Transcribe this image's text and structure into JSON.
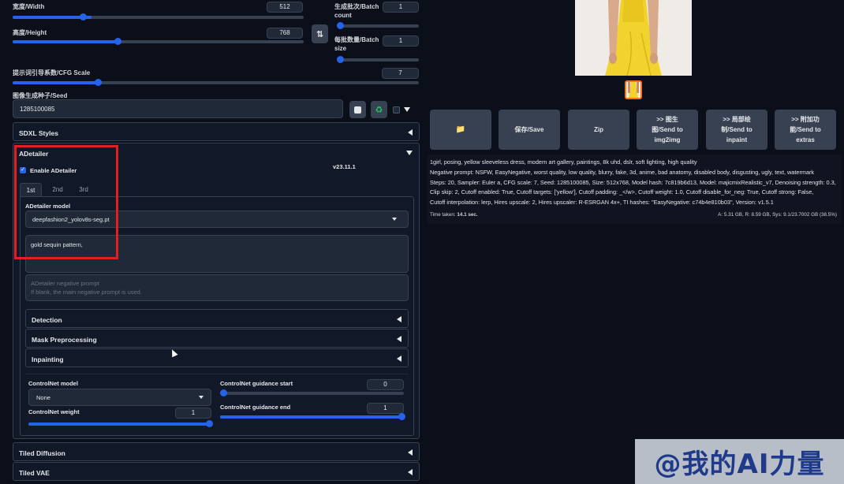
{
  "left": {
    "width": {
      "label": "宽度/Width",
      "value": "512",
      "fraction": 0.3
    },
    "height": {
      "label": "高度/Height",
      "value": "768",
      "fraction": 0.35
    },
    "batch_count": {
      "label_line1": "生成批次/Batch",
      "label_line2": "count",
      "value": "1",
      "fraction": 0.0
    },
    "batch_size": {
      "label_line1": "每批数量/Batch",
      "label_line2": "size",
      "value": "1",
      "fraction": 0.0
    },
    "cfg": {
      "label": "提示词引导系数/CFG Scale",
      "value": "7",
      "fraction": 0.21
    },
    "seed": {
      "label": "图像生成种子/Seed",
      "value": "1285100085"
    },
    "sdxl_styles": "SDXL Styles",
    "adetailer": {
      "title": "ADetailer",
      "enable_label": "Enable ADetailer",
      "version": "v23.11.1",
      "tabs": [
        "1st",
        "2nd",
        "3rd"
      ],
      "model_label": "ADetailer model",
      "model_value": "deepfashion2_yolov8s-seg.pt",
      "prompt_value": "gold sequin pattern,",
      "neg_placeholder_line1": "ADetailer negative prompt",
      "neg_placeholder_line2": "If blank, the main negative prompt is used.",
      "sections": [
        "Detection",
        "Mask Preprocessing",
        "Inpainting"
      ],
      "controlnet_model_label": "ControlNet model",
      "controlnet_model_value": "None",
      "controlnet_weight_label": "ControlNet weight",
      "controlnet_weight_value": "1",
      "guidance_start_label": "ControlNet guidance start",
      "guidance_start_value": "0",
      "guidance_end_label": "ControlNet guidance end",
      "guidance_end_value": "1"
    },
    "tiled_diffusion": "Tiled Diffusion",
    "tiled_vae": "Tiled VAE"
  },
  "right": {
    "buttons": [
      {
        "label": "📁"
      },
      {
        "label": "保存/Save"
      },
      {
        "label": "Zip"
      },
      {
        "label": ">> 图生\n图/Send to\nimg2img"
      },
      {
        "label": ">> 局部绘\n制/Send to\ninpaint"
      },
      {
        "label": ">> 附加功\n能/Send to\nextras"
      }
    ],
    "info_lines": [
      "1girl, posing, yellow sleeveless dress, modern art gallery, paintings, 8k uhd, dslr, soft lighting, high quality",
      "Negative prompt: NSFW, EasyNegative, worst quality, low quality, blurry, fake, 3d, anime, bad anatomy, disabled body, disgusting, ugly, text, watermark",
      "Steps: 20, Sampler: Euler a, CFG scale: 7, Seed: 1285100085, Size: 512x768, Model hash: 7c819b6d13, Model: majicmixRealistic_v7, Denoising strength: 0.3,",
      "Clip skip: 2, Cutoff enabled: True, Cutoff targets: ['yellow'], Cutoff padding: _</w>, Cutoff weight: 1.0, Cutoff disable_for_neg: True, Cutoff strong: False,",
      "Cutoff interpolation: lerp, Hires upscale: 2, Hires upscaler: R-ESRGAN 4x+, TI hashes: \"EasyNegative: c74b4e810b03\", Version: v1.5.1"
    ],
    "time_label": "Time taken:",
    "time_value": "14.1 sec.",
    "vram": "A: 5.31 GB, R: 8.59 GB, Sys: 9.1/23.7002 GB (38.5%)"
  },
  "watermark": "@我的AI力量",
  "colors": {
    "accent": "#2563eb",
    "highlight": "#e02020",
    "dress": "#f2d22c",
    "background": "#0b0f19"
  }
}
